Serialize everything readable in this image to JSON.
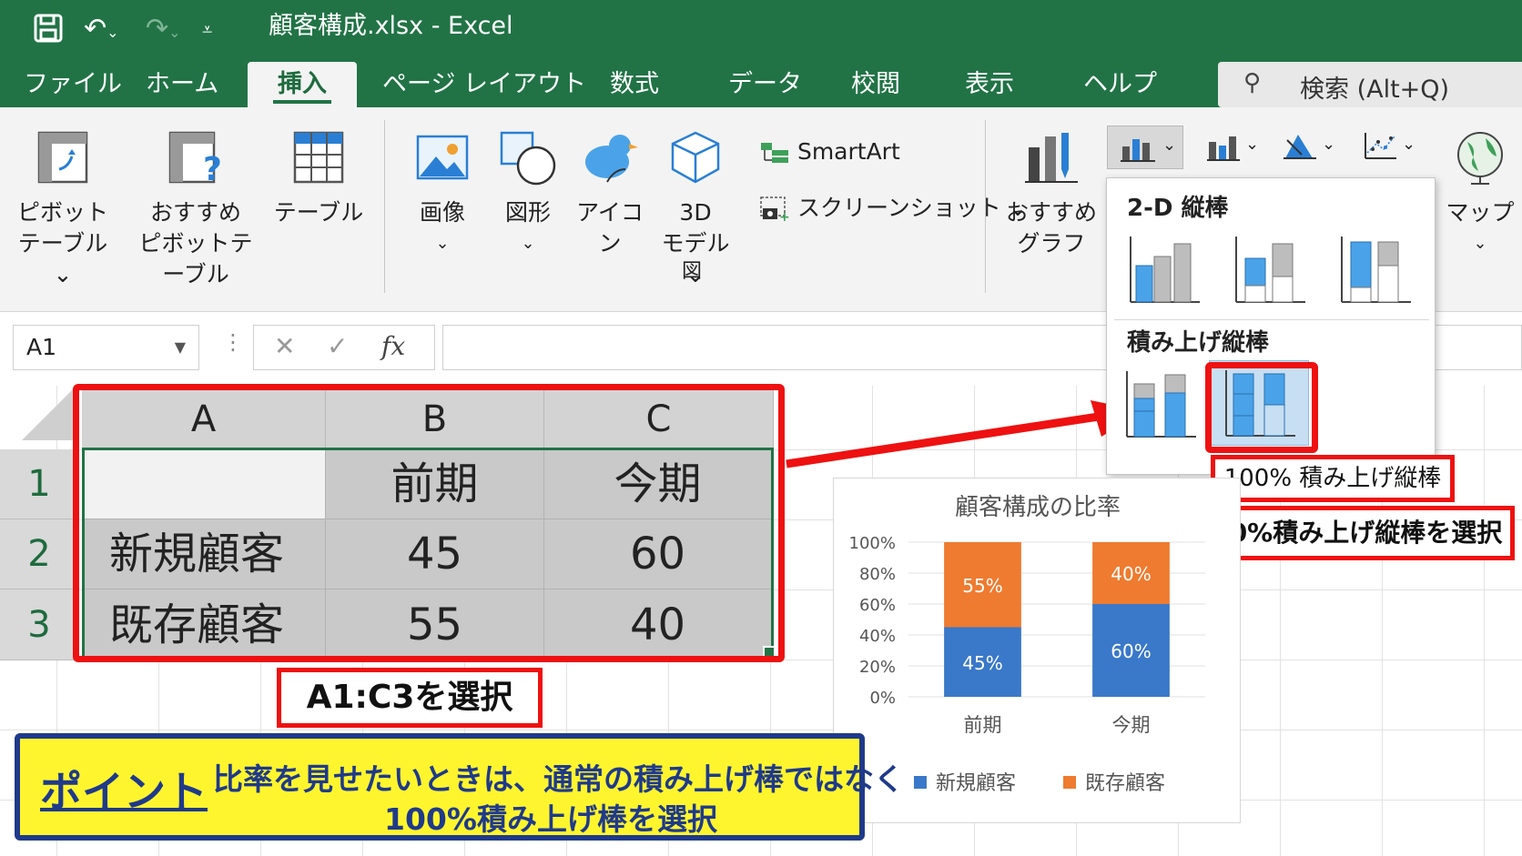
{
  "app": {
    "title": "顧客構成.xlsx  -  Excel"
  },
  "tabs": [
    {
      "label": "ファイル"
    },
    {
      "label": "ホーム"
    },
    {
      "label": "挿入"
    },
    {
      "label": "ページ レイアウト"
    },
    {
      "label": "数式"
    },
    {
      "label": "データ"
    },
    {
      "label": "校閲"
    },
    {
      "label": "表示"
    },
    {
      "label": "ヘルプ"
    }
  ],
  "search": {
    "placeholder": "検索 (Alt+Q)"
  },
  "ribbon": {
    "pivot_table": [
      "ピボット",
      "テーブル ⌄"
    ],
    "recommended_pivot": [
      "おすすめ",
      "ピボットテーブル"
    ],
    "table": "テーブル",
    "image": "画像",
    "shapes": "図形",
    "icons": "アイコン",
    "model3d": [
      "3D",
      "モデル ⌄"
    ],
    "group_zu": "図",
    "smartart": "SmartArt",
    "screenshot": "スクリーンショット ⌄",
    "recommended_chart": [
      "おすすめ",
      "グラフ"
    ],
    "map": "マップ"
  },
  "formula_bar": {
    "name_box": "A1"
  },
  "sheet": {
    "columns": [
      "A",
      "B",
      "C"
    ],
    "rows": [
      "1",
      "2",
      "3"
    ],
    "cells": [
      [
        "",
        "前期",
        "今期"
      ],
      [
        "新規顧客",
        "45",
        "60"
      ],
      [
        "既存顧客",
        "55",
        "40"
      ]
    ]
  },
  "dropdown": {
    "section1": "2-D 縦棒",
    "section2": "積み上げ縦棒"
  },
  "callouts": {
    "tooltip": "100% 積み上げ縦棒",
    "select_chart": "100%積み上げ縦棒を選択",
    "select_range": "A1:C3を選択"
  },
  "point": {
    "label": "ポイント",
    "line1": "比率を見せたいときは、通常の積み上げ棒ではなく",
    "line2": "100%積み上げ棒を選択"
  },
  "colors": {
    "excel_green": "#217346",
    "series_new": "#3a78c9",
    "series_existing": "#ee7b30",
    "highlight_red": "#ee1111"
  },
  "chart_data": {
    "type": "bar",
    "stacked": "percent",
    "title": "顧客構成の比率",
    "categories": [
      "前期",
      "今期"
    ],
    "series": [
      {
        "name": "新規顧客",
        "values": [
          45,
          60
        ],
        "labels": [
          "45%",
          "60%"
        ]
      },
      {
        "name": "既存顧客",
        "values": [
          55,
          40
        ],
        "labels": [
          "55%",
          "40%"
        ]
      }
    ],
    "yticks": [
      "0%",
      "20%",
      "40%",
      "60%",
      "80%",
      "100%"
    ],
    "ylim": [
      0,
      100
    ],
    "legend": "bottom"
  }
}
